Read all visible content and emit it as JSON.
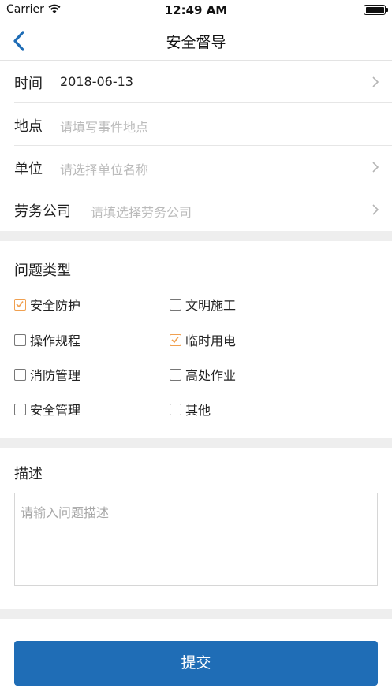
{
  "status_bar": {
    "carrier": "Carrier",
    "time": "12:49 AM"
  },
  "nav": {
    "title": "安全督导"
  },
  "form": {
    "time": {
      "label": "时间",
      "value": "2018-06-13"
    },
    "location": {
      "label": "地点",
      "placeholder": "请填写事件地点"
    },
    "unit": {
      "label": "单位",
      "placeholder": "请选择单位名称"
    },
    "labor": {
      "label": "劳务公司",
      "placeholder": "请填选择劳务公司"
    }
  },
  "issue_type": {
    "title": "问题类型",
    "options": [
      {
        "label": "安全防护",
        "checked": true
      },
      {
        "label": "文明施工",
        "checked": false
      },
      {
        "label": "操作规程",
        "checked": false
      },
      {
        "label": "临时用电",
        "checked": true
      },
      {
        "label": "消防管理",
        "checked": false
      },
      {
        "label": "高处作业",
        "checked": false
      },
      {
        "label": "安全管理",
        "checked": false
      },
      {
        "label": "其他",
        "checked": false
      }
    ]
  },
  "description": {
    "title": "描述",
    "placeholder": "请输入问题描述"
  },
  "submit": {
    "label": "提交"
  },
  "colors": {
    "accent": "#1f6db6",
    "checked": "#f0a050",
    "background_gap": "#eeeeee"
  }
}
